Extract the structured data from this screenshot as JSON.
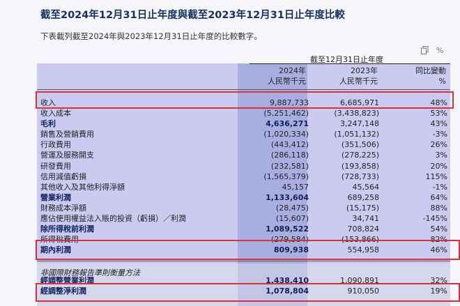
{
  "title": "截至2024年12月31日止年度與截至2023年12月31日止年度比較",
  "intro": "下表載列截至2024年與2023年12月31日止年度的比較數字。",
  "toolbar": {
    "copy_icon": "copy-icon",
    "percent_icon": "percent-icon",
    "percent_glyph": "%"
  },
  "table": {
    "period_header": "截至12月31日止年度",
    "columns": [
      {
        "year": "2024年",
        "unit": "人民幣千元"
      },
      {
        "year": "2023年",
        "unit": "人民幣千元"
      },
      {
        "year": "同比變動",
        "unit": "%"
      }
    ],
    "rows": [
      {
        "label": "收入",
        "v2024": "9,887,733",
        "v2023": "6,685,971",
        "change": "48%",
        "bold": false
      },
      {
        "label": "收入成本",
        "v2024": "(5,251,462)",
        "v2023": "(3,438,823)",
        "change": "53%",
        "bold": false
      },
      {
        "label": "毛利",
        "v2024": "4,636,271",
        "v2023": "3,247,148",
        "change": "43%",
        "bold": true
      },
      {
        "label": "銷售及營銷費用",
        "v2024": "(1,020,334)",
        "v2023": "(1,051,132)",
        "change": "-3%",
        "bold": false
      },
      {
        "label": "行政費用",
        "v2024": "(443,412)",
        "v2023": "(351,506)",
        "change": "26%",
        "bold": false
      },
      {
        "label": "營運及服務開支",
        "v2024": "(286,118)",
        "v2023": "(278,225)",
        "change": "3%",
        "bold": false
      },
      {
        "label": "研發費用",
        "v2024": "(232,581)",
        "v2023": "(193,858)",
        "change": "20%",
        "bold": false
      },
      {
        "label": "信用減值虧損",
        "v2024": "(1,565,379)",
        "v2023": "(728,733)",
        "change": "115%",
        "bold": false
      },
      {
        "label": "其他收入及其他利得淨額",
        "v2024": "45,157",
        "v2023": "45,564",
        "change": "-1%",
        "bold": false
      },
      {
        "label": "營業利潤",
        "v2024": "1,133,604",
        "v2023": "689,258",
        "change": "64%",
        "bold": true
      },
      {
        "label": "財務成本淨額",
        "v2024": "(28,475)",
        "v2023": "(15,175)",
        "change": "88%",
        "bold": false
      },
      {
        "label": "應佔使用權益法入賬的投資（虧損）／利潤",
        "v2024": "(15,607)",
        "v2023": "34,741",
        "change": "-145%",
        "bold": false
      },
      {
        "label": "除所得稅前利潤",
        "v2024": "1,089,522",
        "v2023": "708,824",
        "change": "54%",
        "bold": true
      },
      {
        "label": "所得稅費用",
        "v2024": "(279,584)",
        "v2023": "(153,866)",
        "change": "82%",
        "bold": false
      },
      {
        "label": "期內利潤",
        "v2024": "809,938",
        "v2023": "554,958",
        "change": "46%",
        "bold": true
      }
    ],
    "non_ifrs_header": "非國際財務報告準則衡量方法",
    "non_ifrs_rows": [
      {
        "label": "經調整營業利潤",
        "v2024": "1,438,410",
        "v2023": "1,090,891",
        "change": "32%",
        "bold": true
      },
      {
        "label": "經調整淨利潤",
        "v2024": "1,078,804",
        "v2023": "910,050",
        "change": "19%",
        "bold": true
      }
    ]
  },
  "highlight_color": "#d9303a"
}
